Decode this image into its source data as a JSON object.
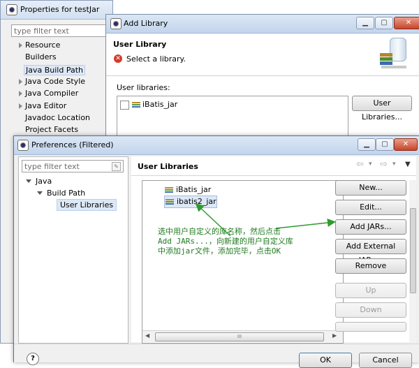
{
  "properties_window": {
    "title": "Properties for testJar",
    "filter_placeholder": "type filter text",
    "tree": [
      {
        "label": "Resource",
        "expandable": true
      },
      {
        "label": "Builders",
        "expandable": false
      },
      {
        "label": "Java Build Path",
        "expandable": false,
        "selected": true
      },
      {
        "label": "Java Code Style",
        "expandable": true
      },
      {
        "label": "Java Compiler",
        "expandable": true
      },
      {
        "label": "Java Editor",
        "expandable": true
      },
      {
        "label": "Javadoc Location",
        "expandable": false
      },
      {
        "label": "Project Facets",
        "expandable": false
      }
    ]
  },
  "add_library_dialog": {
    "title": "Add Library",
    "heading": "User Library",
    "message": "Select a library.",
    "user_libraries_label": "User libraries:",
    "libraries": [
      {
        "name": "iBatis_jar",
        "checked": false
      }
    ],
    "user_libraries_button": "User Libraries...",
    "window_buttons": {
      "minimize": "▁",
      "maximize": "▢",
      "close": "✕"
    }
  },
  "preferences_window": {
    "title": "Preferences (Filtered)",
    "filter_placeholder": "type filter text",
    "tree": {
      "root": "Java",
      "child": "Build Path",
      "leaf": "User Libraries"
    },
    "page_title": "User Libraries",
    "libraries": [
      "iBatis_jar",
      "ibatis2_jar"
    ],
    "buttons": {
      "new": "New...",
      "edit": "Edit...",
      "add_jars": "Add JARs...",
      "add_external_jars": "Add External JARs...",
      "remove": "Remove",
      "up": "Up",
      "down": "Down"
    },
    "annotation": "选中用户自定义的库名称，然后点击\nAdd JARs...，向新建的用户自定义库\n中添加jar文件，添加完毕，点击OK",
    "ok_label": "OK",
    "cancel_label": "Cancel",
    "help_icon": "?",
    "scroll_thumb": "III"
  },
  "colors": {
    "annotation_text": "#1f7a1f",
    "arrow": "#2e9b2e",
    "title_bar": "#c3d5ec",
    "selection": "#dde8f6"
  }
}
